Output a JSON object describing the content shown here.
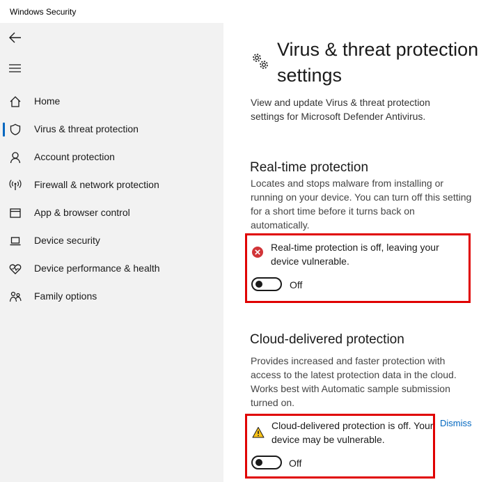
{
  "window": {
    "title": "Windows Security"
  },
  "sidebar": {
    "items": [
      {
        "label": "Home",
        "icon": "home-icon"
      },
      {
        "label": "Virus & threat protection",
        "icon": "shield-icon",
        "active": true
      },
      {
        "label": "Account protection",
        "icon": "person-icon"
      },
      {
        "label": "Firewall & network protection",
        "icon": "wifi-antenna-icon"
      },
      {
        "label": "App & browser control",
        "icon": "app-window-icon"
      },
      {
        "label": "Device security",
        "icon": "laptop-icon"
      },
      {
        "label": "Device performance & health",
        "icon": "heart-pulse-icon"
      },
      {
        "label": "Family options",
        "icon": "family-icon"
      }
    ]
  },
  "main": {
    "title": "Virus & threat protection settings",
    "description": "View and update Virus & threat protection settings for Microsoft Defender Antivirus.",
    "realtime": {
      "title": "Real-time protection",
      "description": "Locates and stops malware from installing or running on your device. You can turn off this setting for a short time before it turns back on automatically.",
      "alert": "Real-time protection is off, leaving your device vulnerable.",
      "toggle_label": "Off",
      "toggle_on": false
    },
    "cloud": {
      "title": "Cloud-delivered protection",
      "description": "Provides increased and faster protection with access to the latest protection data in the cloud. Works best with Automatic sample submission turned on.",
      "alert": "Cloud-delivered protection is off. Your device may be vulnerable.",
      "dismiss": "Dismiss",
      "toggle_label": "Off",
      "toggle_on": false
    }
  },
  "colors": {
    "accent": "#0067c0",
    "alert_border": "#e00000",
    "error_icon": "#d13438",
    "warning_icon": "#fcc419",
    "sidebar_bg": "#f2f2f2"
  }
}
